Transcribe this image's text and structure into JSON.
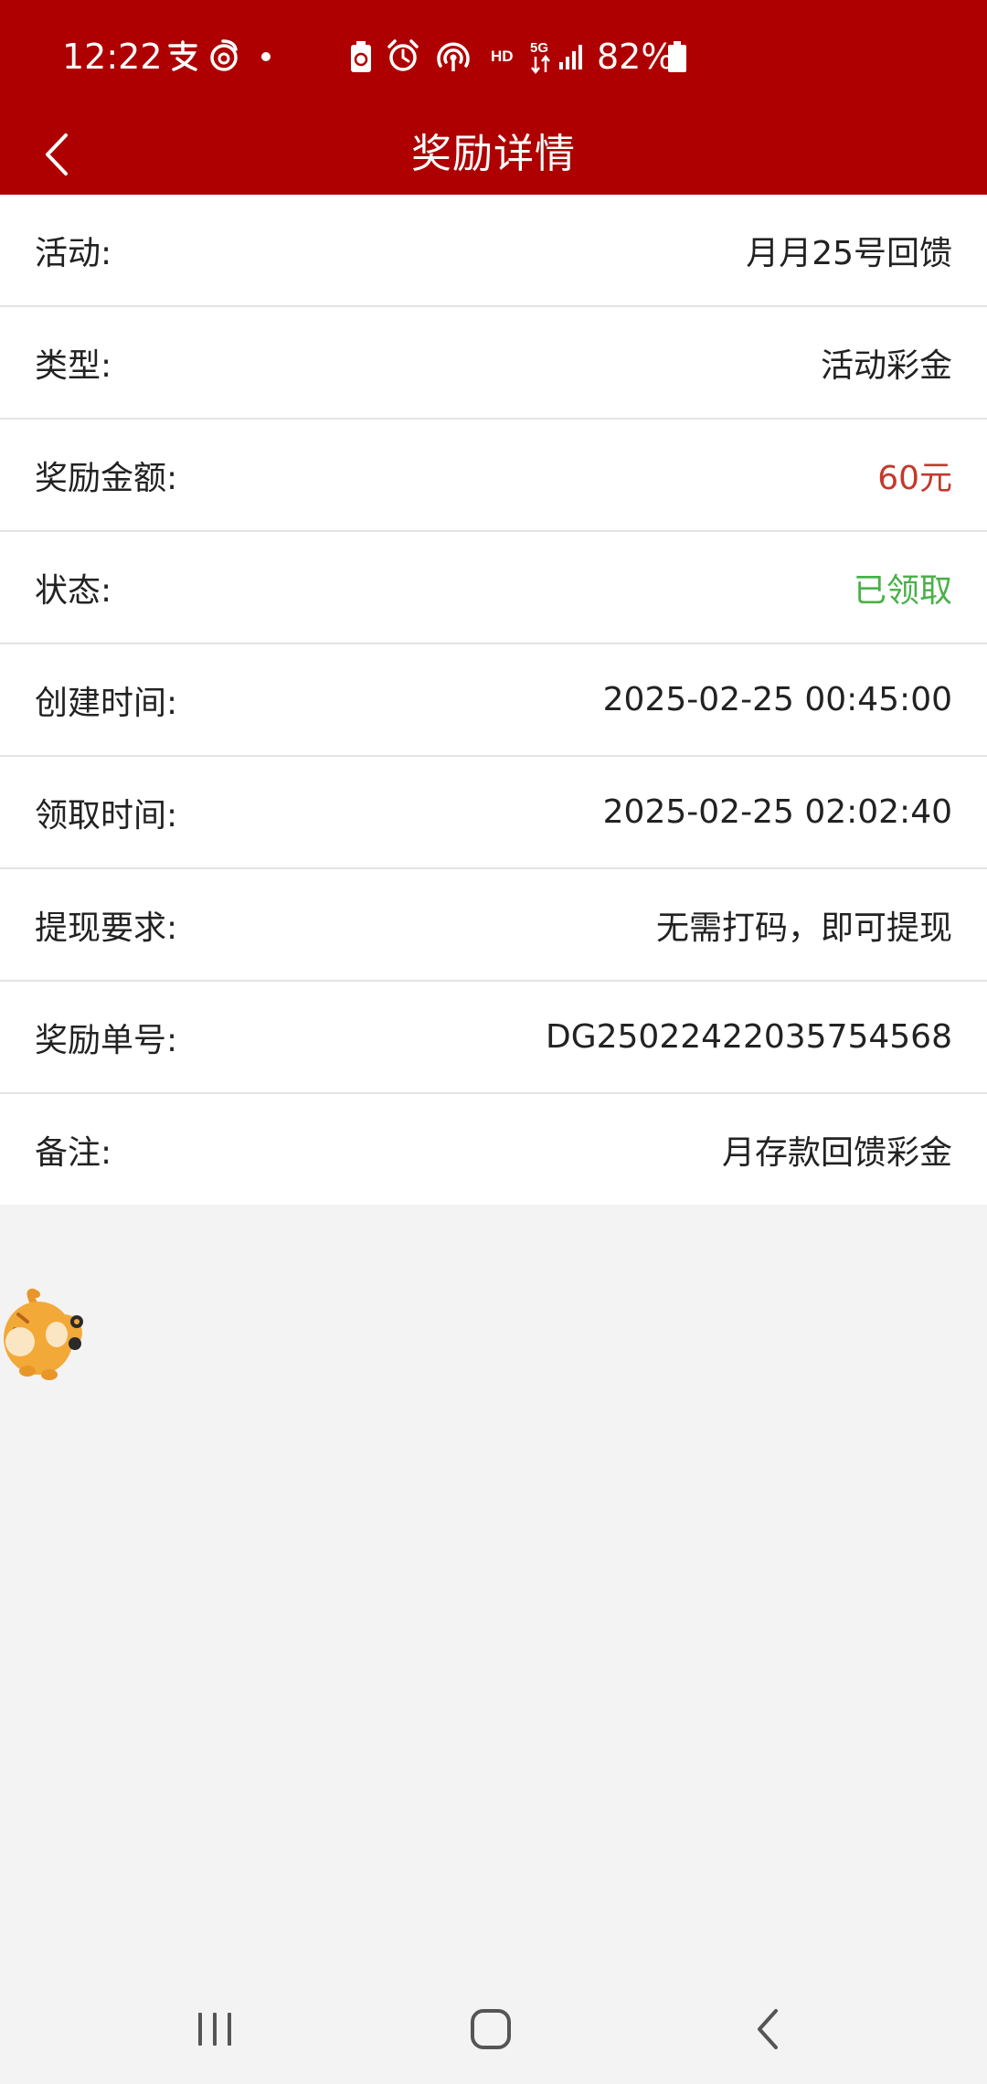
{
  "status_bar": {
    "time": "12:22",
    "battery_text": "82%",
    "icons": [
      "alipay-icon",
      "weibo-icon",
      "dot-icon",
      "battery-saver-icon",
      "alarm-icon",
      "hotspot-icon",
      "hd-icon",
      "5g-icon",
      "signal-icon",
      "battery-icon"
    ]
  },
  "header": {
    "title": "奖励详情",
    "back_icon": "chevron-left-icon"
  },
  "details": [
    {
      "label": "活动:",
      "value": "月月25号回馈"
    },
    {
      "label": "类型:",
      "value": "活动彩金"
    },
    {
      "label": "奖励金额:",
      "value": "60元",
      "value_color": "#c2392d"
    },
    {
      "label": "状态:",
      "value": "已领取",
      "value_color": "#49b149"
    },
    {
      "label": "创建时间:",
      "value": "2025-02-25 00:45:00"
    },
    {
      "label": "领取时间:",
      "value": "2025-02-25 02:02:40"
    },
    {
      "label": "提现要求:",
      "value": "无需打码，即可提现"
    },
    {
      "label": "奖励单号:",
      "value": "DG25022422035754568"
    },
    {
      "label": "备注:",
      "value": "月存款回馈彩金"
    }
  ],
  "floating_widget": {
    "icon": "tiger-mascot-icon"
  },
  "nav_bar": {
    "buttons": [
      "recent-apps-icon",
      "home-icon",
      "back-icon"
    ]
  },
  "colors": {
    "brand": "#ae0000",
    "page_bg": "#f3f3f3",
    "amount": "#c2392d",
    "status_claimed": "#49b149"
  }
}
